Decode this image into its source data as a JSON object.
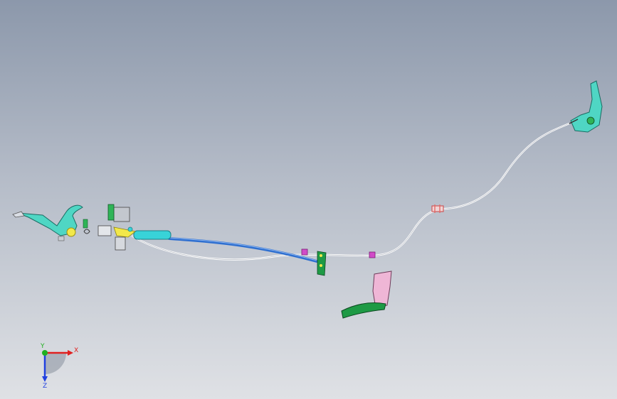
{
  "viewport": {
    "background_top": "#8c98ab",
    "background_bottom": "#dfe1e5"
  },
  "model": {
    "cable_color": "#ffffff",
    "sleeve_color": "#2e6fd0",
    "sleeve_highlight": "#38d3d8",
    "lever_color": "#4fd6c4",
    "bracket_color": "#1e9a45",
    "clip_color": "#d14bc8",
    "connector_color": "#e36a6a",
    "accent_yellow": "#f2e84a",
    "pink_part_color": "#efb6d6"
  },
  "triad": {
    "x_label": "X",
    "y_label": "Y",
    "z_label": "Z",
    "x_color": "#e02020",
    "y_color": "#20b020",
    "z_color": "#2040e0"
  }
}
